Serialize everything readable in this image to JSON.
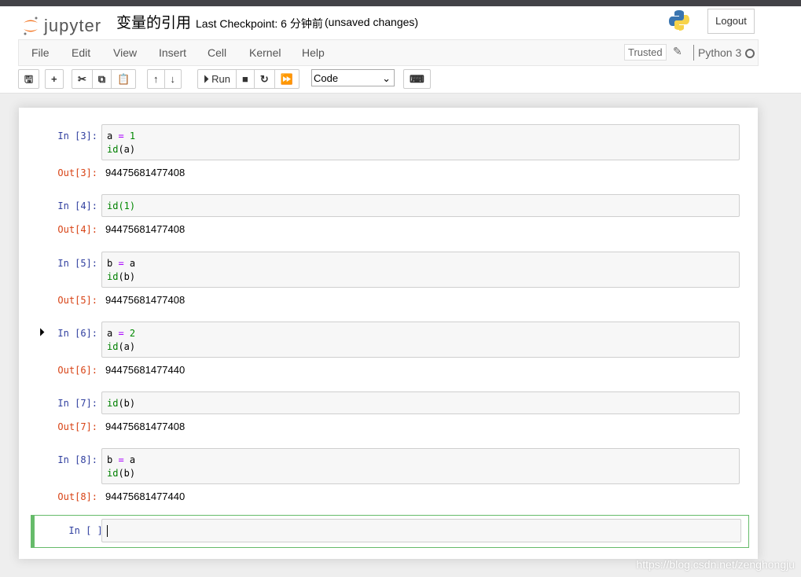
{
  "header": {
    "logo_text": "jupyter",
    "notebook_name": "变量的引用",
    "checkpoint": "Last Checkpoint: 6 分钟前",
    "unsaved": "(unsaved changes)",
    "logout": "Logout"
  },
  "menubar": {
    "items": [
      "File",
      "Edit",
      "View",
      "Insert",
      "Cell",
      "Kernel",
      "Help"
    ],
    "trusted": "Trusted",
    "kernel": "Python 3"
  },
  "toolbar": {
    "run_label": "Run",
    "cell_type": "Code",
    "icons": [
      "save-icon",
      "plus-icon",
      "cut-icon",
      "copy-icon",
      "paste-icon",
      "arrow-up-icon",
      "arrow-down-icon",
      "run-icon",
      "stop-icon",
      "restart-icon",
      "fast-forward-icon",
      "keyboard-icon"
    ]
  },
  "cells": [
    {
      "in": "In [3]:",
      "lines": [
        [
          [
            "a",
            "var"
          ],
          [
            " = ",
            "op"
          ],
          [
            "1",
            "num"
          ]
        ],
        [
          [
            "id",
            "bi"
          ],
          [
            "(a)",
            "p"
          ]
        ]
      ],
      "out": "Out[3]:",
      "result": "94475681477408"
    },
    {
      "in": "In [4]:",
      "lines": [
        [
          [
            "id",
            "bi"
          ],
          [
            "(1)",
            "num"
          ]
        ]
      ],
      "out": "Out[4]:",
      "result": "94475681477408"
    },
    {
      "in": "In [5]:",
      "lines": [
        [
          [
            "b",
            "var"
          ],
          [
            " = ",
            "op"
          ],
          [
            "a",
            "var"
          ]
        ],
        [
          [
            "id",
            "bi"
          ],
          [
            "(b)",
            "p"
          ]
        ]
      ],
      "out": "Out[5]:",
      "result": "94475681477408"
    },
    {
      "in": "In [6]:",
      "lines": [
        [
          [
            "a",
            "var"
          ],
          [
            " = ",
            "op"
          ],
          [
            "2",
            "num"
          ]
        ],
        [
          [
            "id",
            "bi"
          ],
          [
            "(a)",
            "p"
          ]
        ]
      ],
      "out": "Out[6]:",
      "result": "94475681477440",
      "running": true
    },
    {
      "in": "In [7]:",
      "lines": [
        [
          [
            "id",
            "bi"
          ],
          [
            "(b)",
            "p"
          ]
        ]
      ],
      "out": "Out[7]:",
      "result": "94475681477408"
    },
    {
      "in": "In [8]:",
      "lines": [
        [
          [
            "b",
            "var"
          ],
          [
            " = ",
            "op"
          ],
          [
            "a",
            "var"
          ]
        ],
        [
          [
            "id",
            "bi"
          ],
          [
            "(b)",
            "p"
          ]
        ]
      ],
      "out": "Out[8]:",
      "result": "94475681477440"
    }
  ],
  "empty_cell": {
    "in": "In [ ]:"
  },
  "watermark": "https://blog.csdn.net/zenghongju"
}
